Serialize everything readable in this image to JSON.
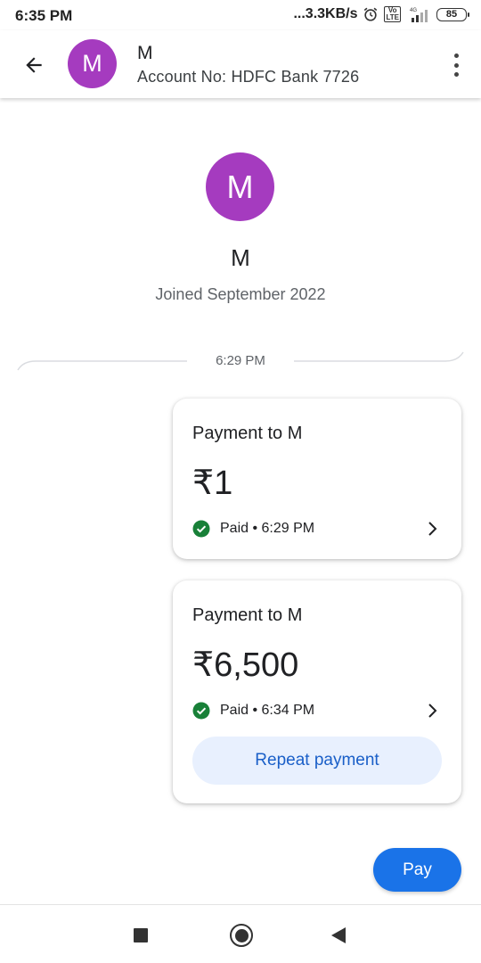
{
  "status_bar": {
    "time": "6:35 PM",
    "net_speed": "...3.3KB/s",
    "volte_label": "Vo\nLTE",
    "network_label": "4G",
    "battery": "85"
  },
  "header": {
    "avatar_letter": "M",
    "name": "M",
    "account": "Account No: HDFC Bank 7726"
  },
  "profile": {
    "avatar_letter": "M",
    "name": "M",
    "joined": "Joined September 2022"
  },
  "thread": {
    "divider_time": "6:29 PM"
  },
  "payments": [
    {
      "title": "Payment to M",
      "amount": "₹1",
      "status": "Paid • 6:29 PM"
    },
    {
      "title": "Payment to M",
      "amount": "₹6,500",
      "status": "Paid • 6:34 PM",
      "action_label": "Repeat payment"
    }
  ],
  "pay_button": {
    "label": "Pay"
  },
  "colors": {
    "avatar": "#a53bbf",
    "primary": "#1a73e8",
    "success": "#188038",
    "repeat_bg": "#e8f0fe",
    "repeat_text": "#1a5fc8"
  },
  "icons": {
    "back": "arrow-back-icon",
    "more": "more-vert-icon",
    "check": "check-circle-icon",
    "chevron": "chevron-right-icon",
    "alarm": "alarm-icon",
    "signal": "signal-icon",
    "battery": "battery-icon"
  }
}
